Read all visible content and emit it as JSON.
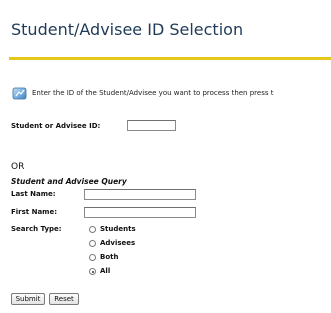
{
  "header": {
    "title": "Student/Advisee ID Selection",
    "rule_color": "#e6c81a",
    "title_color": "#1f3b58"
  },
  "instructions": {
    "icon": "info-icon",
    "text": "Enter the ID of the Student/Advisee you want to process then press t"
  },
  "id_lookup": {
    "label": "Student or Advisee ID:",
    "value": ""
  },
  "or_text": "OR",
  "query": {
    "heading": "Student and Advisee Query",
    "last_name_label": "Last Name:",
    "last_name_value": "",
    "first_name_label": "First Name:",
    "first_name_value": "",
    "search_type_label": "Search Type:",
    "options": [
      {
        "label": "Students",
        "checked": false
      },
      {
        "label": "Advisees",
        "checked": false
      },
      {
        "label": "Both",
        "checked": false
      },
      {
        "label": "All",
        "checked": true
      }
    ]
  },
  "buttons": {
    "submit_label": "Submit",
    "reset_label": "Reset"
  }
}
